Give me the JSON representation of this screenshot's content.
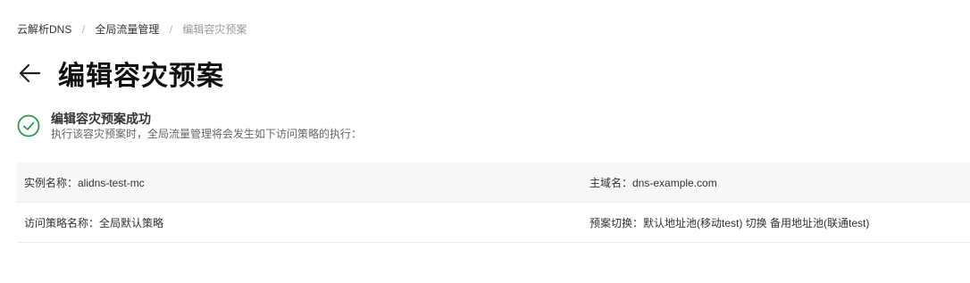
{
  "breadcrumb": {
    "items": [
      "云解析DNS",
      "全局流量管理",
      "编辑容灾预案"
    ],
    "separator": "/"
  },
  "header": {
    "back_icon": "arrow-left-icon",
    "title": "编辑容灾预案"
  },
  "result": {
    "icon": "check-circle-icon",
    "title": "编辑容灾预案成功",
    "description": "执行该容灾预案时，全局流量管理将会发生如下访问策略的执行："
  },
  "details": {
    "rows": [
      {
        "left": "实例名称：alidns-test-mc",
        "right": "主域名：dns-example.com"
      },
      {
        "left": "访问策略名称：全局默认策略",
        "right": "预案切换：默认地址池(移动test) 切换 备用地址池(联通test)"
      }
    ]
  },
  "colors": {
    "success": "#2a9d4a",
    "row_shade": "#f7f7f7",
    "title_text": "#111111"
  }
}
